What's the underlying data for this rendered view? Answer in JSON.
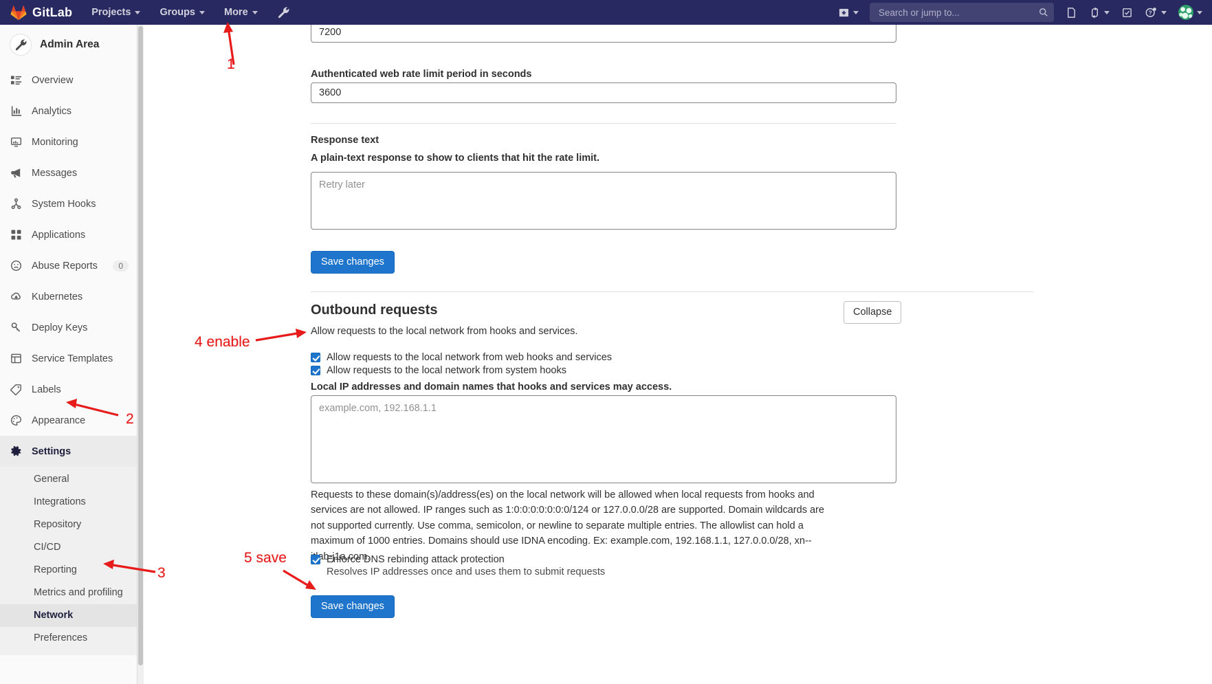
{
  "topnav": {
    "brand": "GitLab",
    "logo_icon": "gitlab-tanuki-icon",
    "items": [
      {
        "label": "Projects",
        "icon": "chevron-down-icon"
      },
      {
        "label": "Groups",
        "icon": "chevron-down-icon"
      },
      {
        "label": "More",
        "icon": "chevron-down-icon"
      }
    ],
    "admin_wrench_icon": "wrench-icon",
    "new_icon": "plus-square-icon",
    "new_chevron_icon": "chevron-down-icon",
    "search": {
      "placeholder": "Search or jump to...",
      "value": "",
      "icon": "search-icon"
    },
    "right_icons": [
      {
        "name": "issues-icon",
        "chevron": false
      },
      {
        "name": "merge-requests-icon",
        "chevron": true
      },
      {
        "name": "todos-icon",
        "chevron": false
      },
      {
        "name": "help-icon",
        "chevron": true
      }
    ],
    "avatar_icon": "user-avatar",
    "avatar_chevron_icon": "chevron-down-icon"
  },
  "sidebar": {
    "title": "Admin Area",
    "title_icon": "wrench-icon",
    "items": [
      {
        "label": "Overview",
        "icon": "overview-icon",
        "badge": ""
      },
      {
        "label": "Analytics",
        "icon": "chart-icon",
        "badge": ""
      },
      {
        "label": "Monitoring",
        "icon": "monitor-icon",
        "badge": ""
      },
      {
        "label": "Messages",
        "icon": "megaphone-icon",
        "badge": ""
      },
      {
        "label": "System Hooks",
        "icon": "hook-icon",
        "badge": ""
      },
      {
        "label": "Applications",
        "icon": "applications-icon",
        "badge": ""
      },
      {
        "label": "Abuse Reports",
        "icon": "abuse-icon",
        "badge": "0"
      },
      {
        "label": "Kubernetes",
        "icon": "kubernetes-icon",
        "badge": ""
      },
      {
        "label": "Deploy Keys",
        "icon": "key-icon",
        "badge": ""
      },
      {
        "label": "Service Templates",
        "icon": "template-icon",
        "badge": ""
      },
      {
        "label": "Labels",
        "icon": "label-icon",
        "badge": ""
      },
      {
        "label": "Appearance",
        "icon": "palette-icon",
        "badge": ""
      }
    ],
    "settings": {
      "label": "Settings",
      "icon": "gear-icon",
      "active": true
    },
    "subitems": [
      {
        "label": "General",
        "active": false
      },
      {
        "label": "Integrations",
        "active": false
      },
      {
        "label": "Repository",
        "active": false
      },
      {
        "label": "CI/CD",
        "active": false
      },
      {
        "label": "Reporting",
        "active": false
      },
      {
        "label": "Metrics and profiling",
        "active": false
      },
      {
        "label": "Network",
        "active": true
      },
      {
        "label": "Preferences",
        "active": false
      }
    ]
  },
  "main": {
    "rate_limit": {
      "top_input_value": "7200",
      "auth_web_label": "Authenticated web rate limit period in seconds",
      "auth_web_value": "3600",
      "response_text_title": "Response text",
      "response_text_desc": "A plain-text response to show to clients that hit the rate limit.",
      "response_textarea_placeholder": "Retry later",
      "response_textarea_value": "",
      "save_label": "Save changes"
    },
    "outbound": {
      "title": "Outbound requests",
      "collapse_label": "Collapse",
      "description": "Allow requests to the local network from hooks and services.",
      "checkboxes": [
        {
          "label": "Allow requests to the local network from web hooks and services",
          "checked": true
        },
        {
          "label": "Allow requests to the local network from system hooks",
          "checked": true
        }
      ],
      "allowlist_label": "Local IP addresses and domain names that hooks and services may access.",
      "allowlist_placeholder": "example.com, 192.168.1.1",
      "allowlist_value": "",
      "allowlist_help": "Requests to these domain(s)/address(es) on the local network will be allowed when local requests from hooks and services are not allowed. IP ranges such as 1:0:0:0:0:0:0:0/124 or 127.0.0.0/28 are supported. Domain wildcards are not supported currently. Use comma, semicolon, or newline to separate multiple entries. The allowlist can hold a maximum of 1000 entries. Domains should use IDNA encoding. Ex: example.com, 192.168.1.1, 127.0.0.0/28, xn--itlab-j1a.com.",
      "dns_checkbox": {
        "label": "Enforce DNS rebinding attack protection",
        "checked": true
      },
      "dns_help": "Resolves IP addresses once and uses them to submit requests",
      "save_label": "Save changes"
    }
  },
  "annotations": [
    {
      "id": "1",
      "label": "1"
    },
    {
      "id": "2",
      "label": "2"
    },
    {
      "id": "3",
      "label": "3"
    },
    {
      "id": "4",
      "label": "4 enable"
    },
    {
      "id": "5",
      "label": "5 save"
    }
  ],
  "colors": {
    "nav_bg": "#292961",
    "accent_blue": "#1f75cb",
    "annotation_red": "#e81b1b",
    "sidebar_bg": "#fafafa"
  }
}
